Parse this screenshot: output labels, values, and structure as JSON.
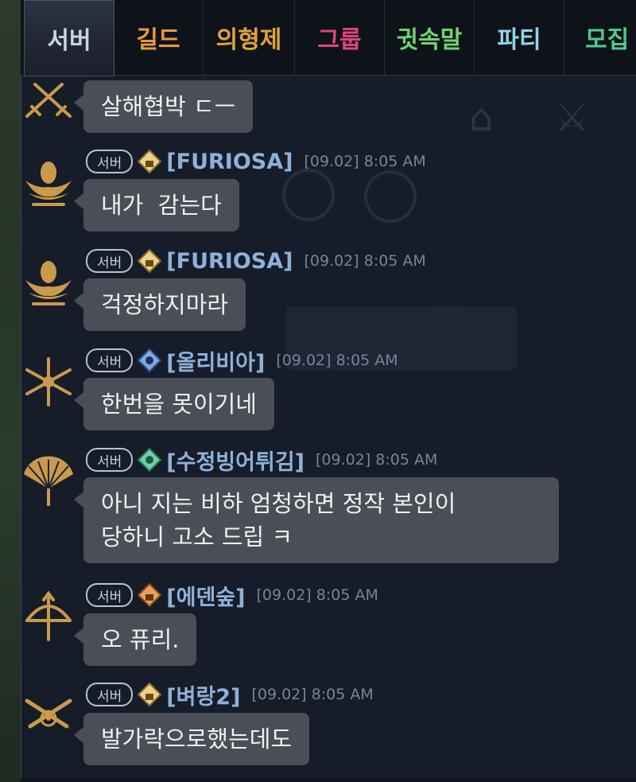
{
  "tabs": [
    {
      "label": "서버",
      "color": "#c8d4e6",
      "active": true
    },
    {
      "label": "길드",
      "color": "#e79a3c"
    },
    {
      "label": "의형제",
      "color": "#e0a23a"
    },
    {
      "label": "그룹",
      "color": "#e0447f"
    },
    {
      "label": "귓속말",
      "color": "#6fd36d"
    },
    {
      "label": "파티",
      "color": "#8fd3e8"
    },
    {
      "label": "모집",
      "color": "#52c98c"
    }
  ],
  "messages": [
    {
      "channel": "",
      "name": "",
      "time": "",
      "avatar": "crossed-swords-icon",
      "rank": "",
      "text": "살해협박 ㄷㅡ"
    },
    {
      "channel": "서버",
      "name": "[FURIOSA]",
      "time": "[09.02] 8:05 AM",
      "avatar": "lotus-icon",
      "rank": "gold-rank-icon",
      "text": "내가  감는다"
    },
    {
      "channel": "서버",
      "name": "[FURIOSA]",
      "time": "[09.02] 8:05 AM",
      "avatar": "lotus-icon",
      "rank": "gold-rank-icon",
      "text": "걱정하지마라"
    },
    {
      "channel": "서버",
      "name": "[올리비아]",
      "time": "[09.02] 8:05 AM",
      "avatar": "star-burst-icon",
      "rank": "blue-rank-icon",
      "text": "한번을 못이기네"
    },
    {
      "channel": "서버",
      "name": "[수정빙어튀김]",
      "time": "[09.02] 8:05 AM",
      "avatar": "fan-icon",
      "rank": "green-rank-icon",
      "text": "아니 지는 비하 엄청하면 정작 본인이\n당하니 고소 드립 ㅋ"
    },
    {
      "channel": "서버",
      "name": "[에덴숲]",
      "time": "[09.02] 8:05 AM",
      "avatar": "bow-icon",
      "rank": "orange-rank-icon",
      "text": "오 퓨리."
    },
    {
      "channel": "서버",
      "name": "[벼랑2]",
      "time": "[09.02] 8:05 AM",
      "avatar": "crossed-guns-icon",
      "rank": "gold-rank-icon",
      "text": "발가락으로했는데도"
    }
  ],
  "colors": {
    "accent_gold": "#c99a4c",
    "username": "#8fb1d9",
    "timestamp": "#78839a",
    "bubble": "#4a4e56"
  }
}
